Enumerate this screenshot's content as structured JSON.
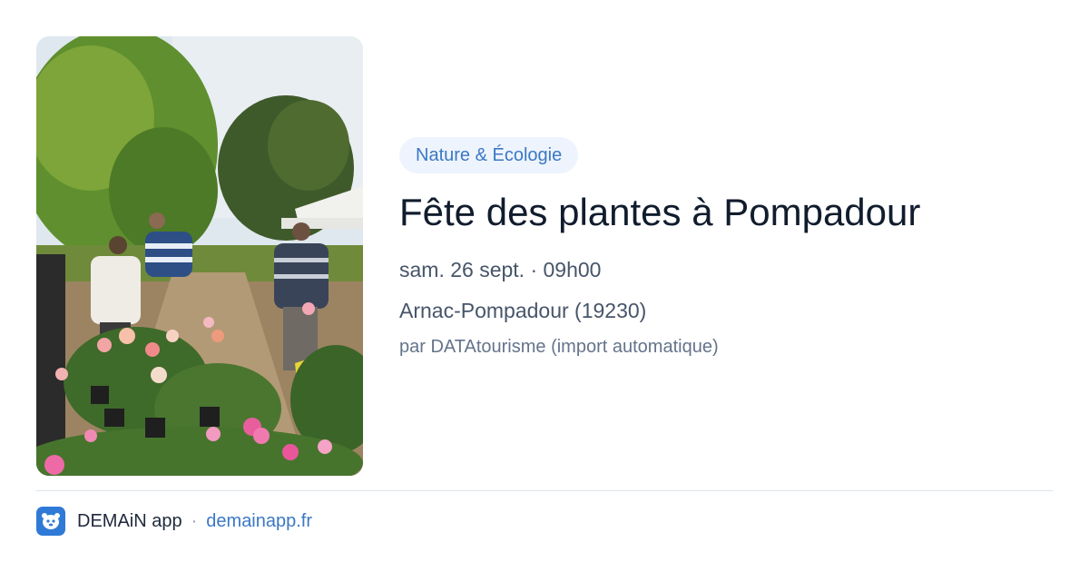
{
  "image": {
    "icon": "event-photo",
    "alt": "Fête des plantes à Pompadour"
  },
  "event": {
    "category": "Nature & Écologie",
    "title": "Fête des plantes à Pompadour",
    "datetime": "sam. 26 sept. · 09h00",
    "location": "Arnac-Pompadour (19230)",
    "author": "par DATAtourisme (import automatique)"
  },
  "footer": {
    "logo_icon": "demain-logo-icon",
    "brand": "DEMAiN app",
    "separator": "·",
    "site": "demainapp.fr"
  },
  "colors": {
    "accent": "#3b78c4",
    "tag_background": "#eef4fd",
    "logo_background": "#2f7ad6"
  }
}
